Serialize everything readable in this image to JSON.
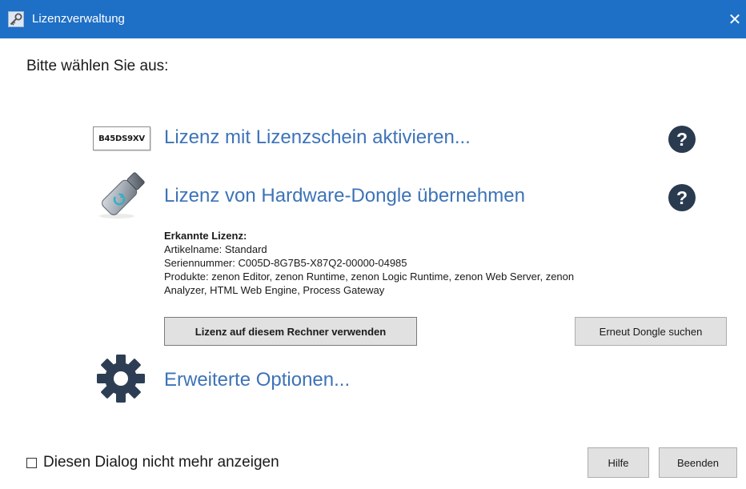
{
  "window": {
    "title": "Lizenzverwaltung",
    "close_glyph": "✕",
    "title_icon": "key-icon",
    "title_bar_color": "#1e6fc6"
  },
  "prompt": "Bitte wählen Sie aus:",
  "options": {
    "activate": {
      "badge_text": "B45DS9XV",
      "label": "Lizenz mit Lizenzschein aktivieren...",
      "help": "?"
    },
    "dongle": {
      "label": "Lizenz von Hardware-Dongle übernehmen",
      "help": "?",
      "icon": "usb-dongle-icon"
    },
    "advanced": {
      "label": "Erweiterte Optionen...",
      "icon": "gear-icon"
    }
  },
  "license_info": {
    "heading": "Erkannte Lizenz:",
    "article": "Artikelname: Standard",
    "serial": "Seriennummer: C005D-8G7B5-X87Q2-00000-04985",
    "products": "Produkte: zenon Editor, zenon Runtime, zenon Logic Runtime, zenon Web Server, zenon Analyzer, HTML Web Engine, Process Gateway"
  },
  "buttons": {
    "use_license": "Lizenz auf diesem Rechner verwenden",
    "search_dongle": "Erneut Dongle suchen",
    "help": "Hilfe",
    "exit": "Beenden"
  },
  "dont_show": {
    "label": "Diesen Dialog nicht mehr anzeigen",
    "checked": false
  },
  "colors": {
    "link": "#3d73b8",
    "help_icon": "#2a3a4f",
    "gear": "#2d3e54"
  }
}
